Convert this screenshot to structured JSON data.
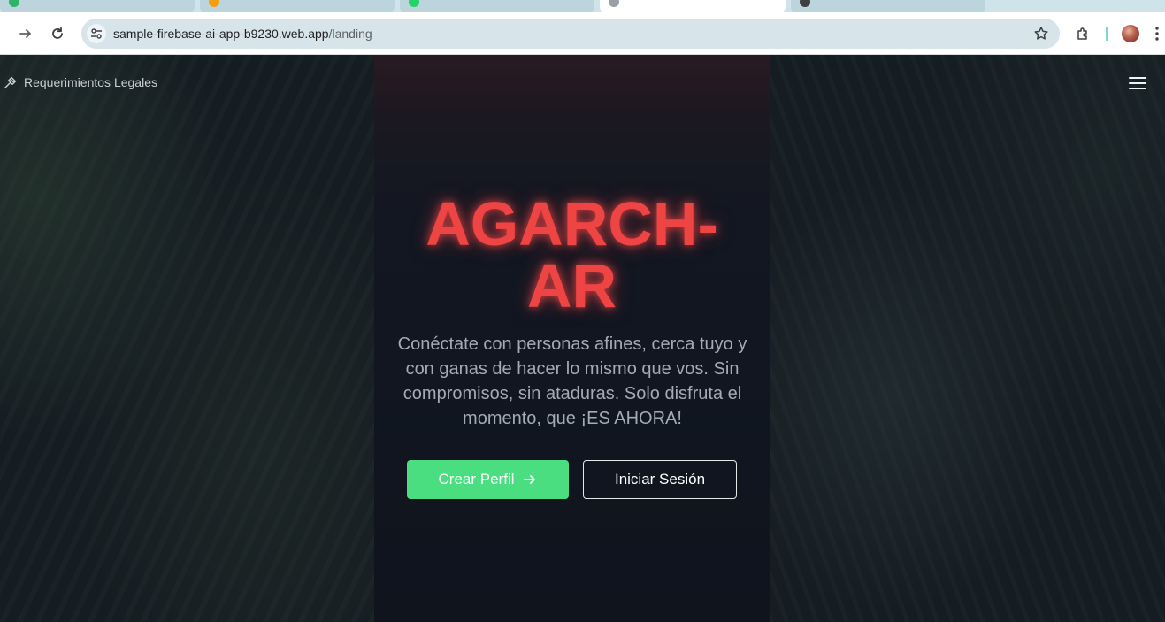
{
  "browser": {
    "url_host": "sample-firebase-ai-app-b9230.web.app",
    "url_path": "/landing"
  },
  "header": {
    "legal_label": "Requerimientos Legales",
    "legal_icon": "gavel-icon",
    "menu_icon": "hamburger-menu-icon"
  },
  "hero": {
    "title_line1": "AGARCH-",
    "title_line2": "AR",
    "tagline": "Conéctate con personas afines, cerca tuyo y con ganas de hacer lo mismo que vos. Sin compromisos, sin ataduras. Solo disfruta el momento, que ¡ES AHORA!",
    "create_profile_label": "Crear Perfil",
    "login_label": "Iniciar Sesión"
  },
  "colors": {
    "accent_red": "#ef4444",
    "primary_green": "#4ade80",
    "background": "#0f141d"
  }
}
